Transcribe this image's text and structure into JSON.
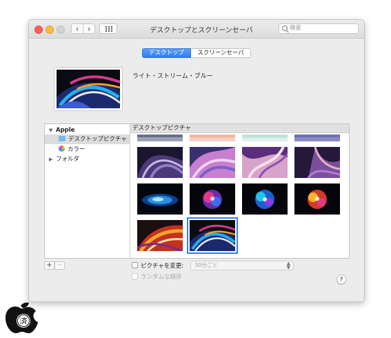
{
  "window": {
    "title": "デスクトップとスクリーンセーバ",
    "search_placeholder": "検索"
  },
  "tabs": [
    {
      "label": "デスクトップ",
      "selected": true
    },
    {
      "label": "スクリーンセーバ",
      "selected": false
    }
  ],
  "current_wallpaper": {
    "name": "ライト・ストリーム・ブルー"
  },
  "sidebar": {
    "group": "Apple",
    "items": [
      {
        "label": "デスクトップピクチャ",
        "icon": "folder-icon",
        "selected": true
      },
      {
        "label": "カラー",
        "icon": "color-wheel-icon",
        "selected": false
      }
    ],
    "folders": "フォルダ"
  },
  "grid": {
    "header": "デスクトップピクチャ",
    "thumbnails": [
      {
        "name": "partial-1"
      },
      {
        "name": "partial-2"
      },
      {
        "name": "partial-3"
      },
      {
        "name": "partial-4"
      },
      {
        "name": "wallpaper-5"
      },
      {
        "name": "wallpaper-6"
      },
      {
        "name": "wallpaper-7"
      },
      {
        "name": "wallpaper-8"
      },
      {
        "name": "wallpaper-9"
      },
      {
        "name": "wallpaper-10"
      },
      {
        "name": "wallpaper-11"
      },
      {
        "name": "wallpaper-12"
      },
      {
        "name": "wallpaper-13"
      },
      {
        "name": "wallpaper-14",
        "selected": true
      }
    ]
  },
  "controls": {
    "plus": "+",
    "minus": "−",
    "change_picture_label": "ピクチャを変更:",
    "interval": "30分ごと",
    "random_order_label": "ランダムな順序",
    "help": "?"
  },
  "watermark": {
    "text": "済"
  }
}
